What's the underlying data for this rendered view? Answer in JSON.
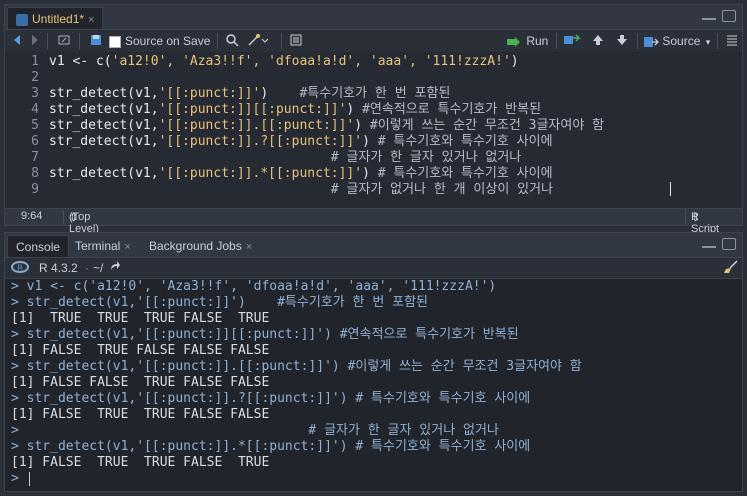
{
  "editor": {
    "tab_label": "Untitled1*",
    "tab_close": "×",
    "toolbar": {
      "source_on_save": "Source on Save",
      "run": "Run",
      "source": "Source"
    },
    "lines": [
      {
        "num": "1",
        "code": "v1 <- c(",
        "str": "'a12!0', 'Aza3!!f', 'dfoaa!a!d', 'aaa', '111!zzzA!'",
        "tail": ")",
        "comment": ""
      },
      {
        "num": "2",
        "code": "",
        "str": "",
        "tail": "",
        "comment": ""
      },
      {
        "num": "3",
        "code": "str_detect(v1,",
        "str": "'[[:punct:]]'",
        "tail": ")    ",
        "comment": "#특수기호가 한 번 포함된"
      },
      {
        "num": "4",
        "code": "str_detect(v1,",
        "str": "'[[:punct:]][[:punct:]]'",
        "tail": ") ",
        "comment": "#연속적으로 특수기호가 반복된"
      },
      {
        "num": "5",
        "code": "str_detect(v1,",
        "str": "'[[:punct:]].[[:punct:]]'",
        "tail": ") ",
        "comment": "#이렇게 쓰는 순간 무조건 3글자여야 함"
      },
      {
        "num": "6",
        "code": "str_detect(v1,",
        "str": "'[[:punct:]].?[[:punct:]]'",
        "tail": ") ",
        "comment": "# 특수기호와 특수기호 사이에"
      },
      {
        "num": "7",
        "code": "",
        "str": "",
        "tail": "                                    ",
        "comment": "# 글자가 한 글자 있거나 없거나"
      },
      {
        "num": "8",
        "code": "str_detect(v1,",
        "str": "'[[:punct:]].*[[:punct:]]'",
        "tail": ") ",
        "comment": "# 특수기호와 특수기호 사이에"
      },
      {
        "num": "9",
        "code": "",
        "str": "",
        "tail": "                                    ",
        "comment": "# 글자가 없거나 한 개 이상이 있거나"
      }
    ],
    "status": {
      "position": "9:64",
      "scope": "(Top Level)",
      "filetype": "R Script"
    }
  },
  "console": {
    "tabs": [
      {
        "label": "Console"
      },
      {
        "label": "Terminal"
      },
      {
        "label": "Background Jobs"
      }
    ],
    "r_version": "R 4.3.2",
    "path": "~/",
    "lines": [
      {
        "kind": "prompt",
        "text": "> v1 <- c('a12!0', 'Aza3!!f', 'dfoaa!a!d', 'aaa', '111!zzzA!')"
      },
      {
        "kind": "prompt",
        "text": "> str_detect(v1,'[[:punct:]]')    #특수기호가 한 번 포함된"
      },
      {
        "kind": "out",
        "text": "[1]  TRUE  TRUE  TRUE FALSE  TRUE"
      },
      {
        "kind": "prompt",
        "text": "> str_detect(v1,'[[:punct:]][[:punct:]]') #연속적으로 특수기호가 반복된"
      },
      {
        "kind": "out",
        "text": "[1] FALSE  TRUE FALSE FALSE FALSE"
      },
      {
        "kind": "prompt",
        "text": "> str_detect(v1,'[[:punct:]].[[:punct:]]') #이렇게 쓰는 순간 무조건 3글자여야 함"
      },
      {
        "kind": "out",
        "text": "[1] FALSE FALSE  TRUE FALSE FALSE"
      },
      {
        "kind": "prompt",
        "text": "> str_detect(v1,'[[:punct:]].?[[:punct:]]') # 특수기호와 특수기호 사이에"
      },
      {
        "kind": "out",
        "text": "[1] FALSE  TRUE  TRUE FALSE FALSE"
      },
      {
        "kind": "prompt",
        "text": ">                                     # 글자가 한 글자 있거나 없거나"
      },
      {
        "kind": "prompt",
        "text": "> str_detect(v1,'[[:punct:]].*[[:punct:]]') # 특수기호와 특수기호 사이에"
      },
      {
        "kind": "out",
        "text": "[1] FALSE  TRUE  TRUE FALSE  TRUE"
      },
      {
        "kind": "prompt",
        "text": "> "
      }
    ]
  },
  "colors": {
    "accent": "#4a90d9",
    "prompt": "#8fb1d6",
    "string": "#e8c27a",
    "run_arrow": "#4caf50"
  }
}
